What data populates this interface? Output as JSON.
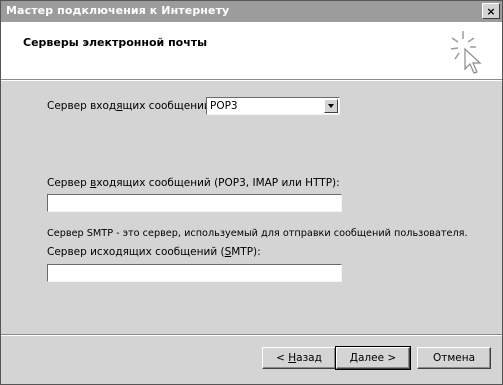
{
  "window": {
    "title": "Мастер подключения к Интернету",
    "close_label": "×"
  },
  "header": {
    "title": "Серверы электронной почты",
    "icon": "wizard-sparkle-cursor-icon"
  },
  "form": {
    "incoming_type_label_pre": "Сервер вход",
    "incoming_type_label_acc": "я",
    "incoming_type_label_post": "щих сообщений:",
    "incoming_type_value": "POP3",
    "incoming_server_label_pre": "Сервер ",
    "incoming_server_label_acc": "в",
    "incoming_server_label_post": "ходящих сообщений (POP3, IMAP или HTTP):",
    "incoming_server_value": "",
    "smtp_description": "Сервер SMTP - это сервер, используемый для отправки сообщений пользователя.",
    "outgoing_server_label_pre": "Сервер исходящих сообщений (",
    "outgoing_server_label_acc": "S",
    "outgoing_server_label_post": "MTP):",
    "outgoing_server_value": ""
  },
  "buttons": {
    "back_arrow": "< ",
    "back_acc": "Н",
    "back_rest": "азад",
    "next_acc": "Д",
    "next_rest": "алее >",
    "cancel": "Отмена"
  }
}
